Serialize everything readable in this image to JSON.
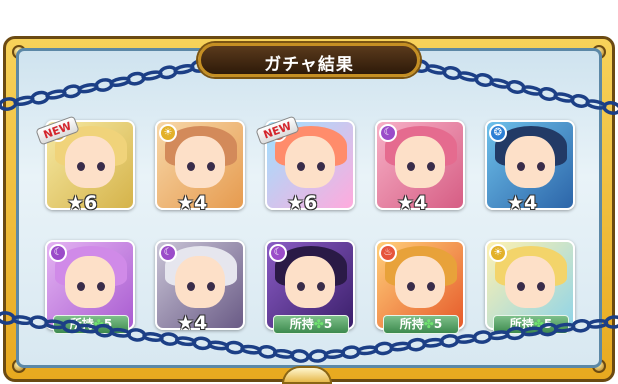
{
  "title": "ガチャ結果",
  "colors": {
    "frame_gold": "#e8a91f",
    "inner_bg": "#d8e8f1",
    "chain_blue": "#1c3f86",
    "owned_green": "#3d8a4e"
  },
  "row1": [
    {
      "element": "light",
      "element_color": "#e3b12a",
      "new": true,
      "new_label": "NEW",
      "rarity": "★6",
      "bg": [
        "#f6e9a3",
        "#d5b34a"
      ],
      "hair": "#f0d37a"
    },
    {
      "element": "light",
      "element_color": "#e3b12a",
      "new": false,
      "rarity": "★4",
      "bg": [
        "#f7d7a8",
        "#e69b4f"
      ],
      "hair": "#d38a5a"
    },
    {
      "element": "fire",
      "element_color": "#e6543c",
      "new": true,
      "new_label": "NEW",
      "rarity": "★6",
      "bg": [
        "#9de2ff",
        "#ffaadd"
      ],
      "hair": "#ff8c6b"
    },
    {
      "element": "dark",
      "element_color": "#9b4cc9",
      "new": false,
      "rarity": "★4",
      "bg": [
        "#f7b0c6",
        "#d65d84"
      ],
      "hair": "#e56b8f"
    },
    {
      "element": "water",
      "element_color": "#2d7fd4",
      "new": false,
      "rarity": "★4",
      "bg": [
        "#6ec0ea",
        "#2c65a9"
      ],
      "hair": "#223a66"
    }
  ],
  "row2": [
    {
      "element": "dark",
      "element_color": "#9b4cc9",
      "owned_label": "所持",
      "owned_count": "5",
      "rarity": null,
      "bg": [
        "#e4b3f2",
        "#a95cd1"
      ],
      "hair": "#d08ae8"
    },
    {
      "element": "dark",
      "element_color": "#9b4cc9",
      "owned_label": null,
      "rarity": "★4",
      "bg": [
        "#c9c4d6",
        "#6a5b86"
      ],
      "hair": "#e6e6ee"
    },
    {
      "element": "dark",
      "element_color": "#9b4cc9",
      "owned_label": "所持",
      "owned_count": "5",
      "rarity": null,
      "bg": [
        "#8a5cc4",
        "#3b1f6b"
      ],
      "hair": "#2a1a46"
    },
    {
      "element": "fire",
      "element_color": "#e6543c",
      "owned_label": "所持",
      "owned_count": "5",
      "rarity": null,
      "bg": [
        "#ffcf7a",
        "#e65a2a"
      ],
      "hair": "#e8a23a"
    },
    {
      "element": "light",
      "element_color": "#e3b12a",
      "owned_label": "所持",
      "owned_count": "5",
      "rarity": null,
      "bg": [
        "#fff1b0",
        "#8fd4e8"
      ],
      "hair": "#f3d46a"
    }
  ]
}
